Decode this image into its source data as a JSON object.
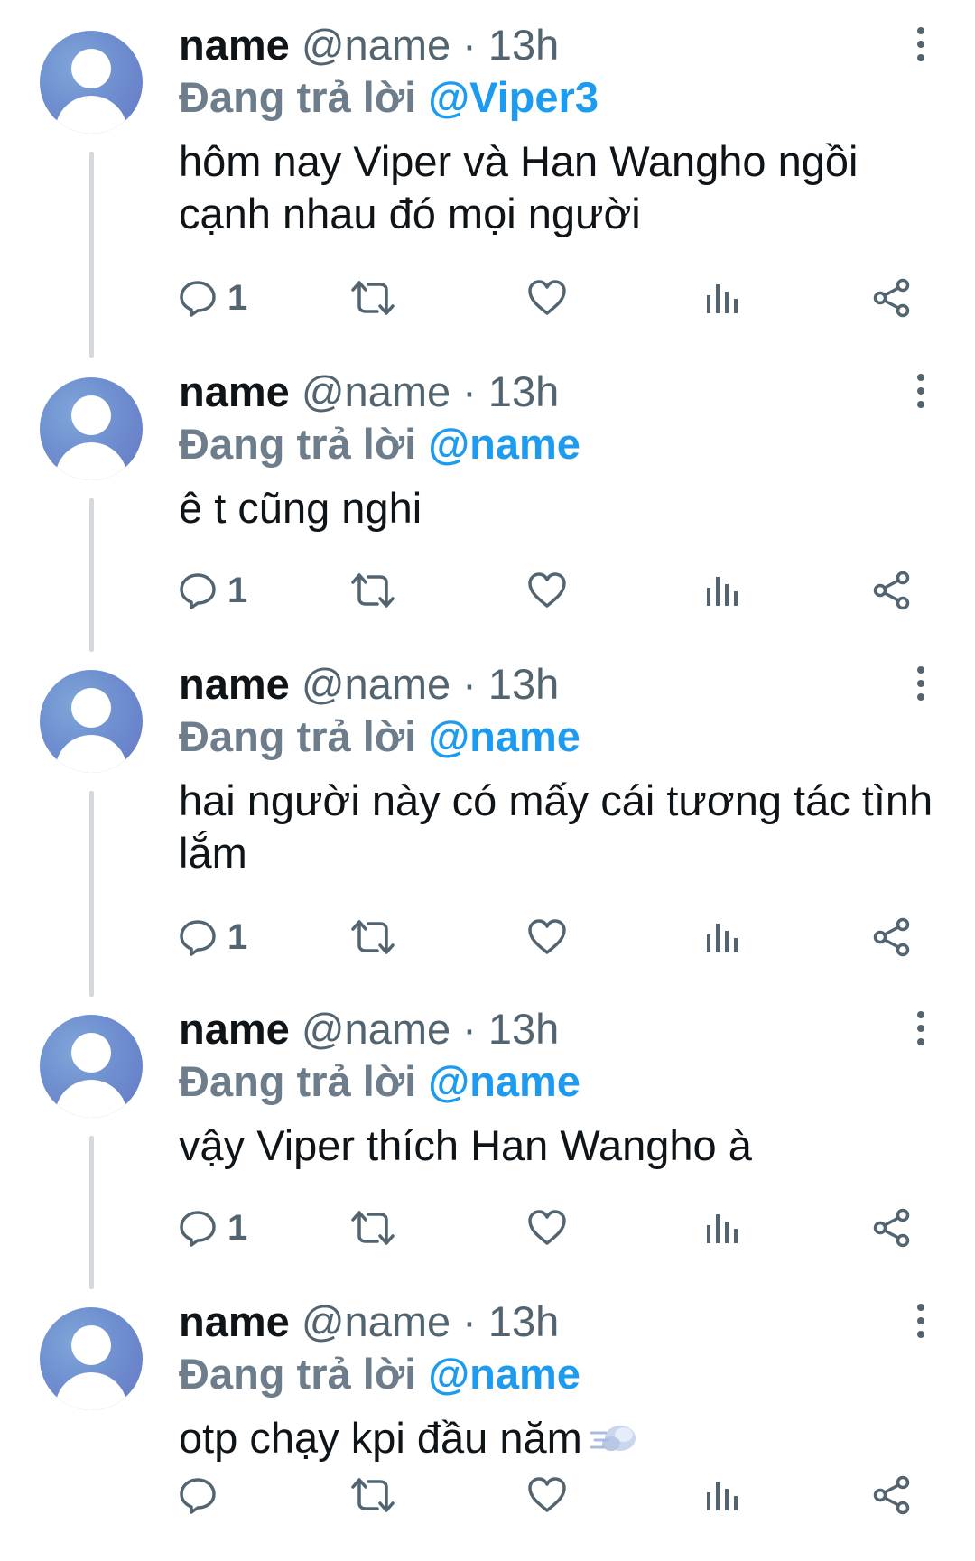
{
  "tweets": [
    {
      "display_name": "name",
      "meta": "@name · 13h",
      "reply_prefix": "Đang trả lời",
      "reply_target": "@Viper3",
      "text": "hôm nay Viper và Han Wangho ngồi cạnh nhau đó mọi người",
      "reply_count": "1"
    },
    {
      "display_name": "name",
      "meta": "@name · 13h",
      "reply_prefix": "Đang trả lời",
      "reply_target": "@name",
      "text": "ê t cũng nghi",
      "reply_count": "1"
    },
    {
      "display_name": "name",
      "meta": "@name · 13h",
      "reply_prefix": "Đang trả lời",
      "reply_target": "@name",
      "text": "hai người này có mấy cái tương tác tình lắm",
      "reply_count": "1"
    },
    {
      "display_name": "name",
      "meta": "@name · 13h",
      "reply_prefix": "Đang trả lời",
      "reply_target": "@name",
      "text": "vậy Viper thích Han Wangho à",
      "reply_count": "1"
    },
    {
      "display_name": "name",
      "meta": "@name · 13h",
      "reply_prefix": "Đang trả lời",
      "reply_target": "@name",
      "text": "otp chạy kpi đầu năm",
      "text_emoji": "dashing-away-emoji",
      "reply_count": ""
    }
  ],
  "icons": {
    "reply": "reply-icon",
    "retweet": "retweet-icon",
    "like": "heart-icon",
    "views": "views-icon",
    "share": "share-icon",
    "more": "more-options-icon"
  },
  "colors": {
    "accent": "#1d9bf0",
    "muted": "#536471",
    "thread_line": "#d4d9dd"
  }
}
